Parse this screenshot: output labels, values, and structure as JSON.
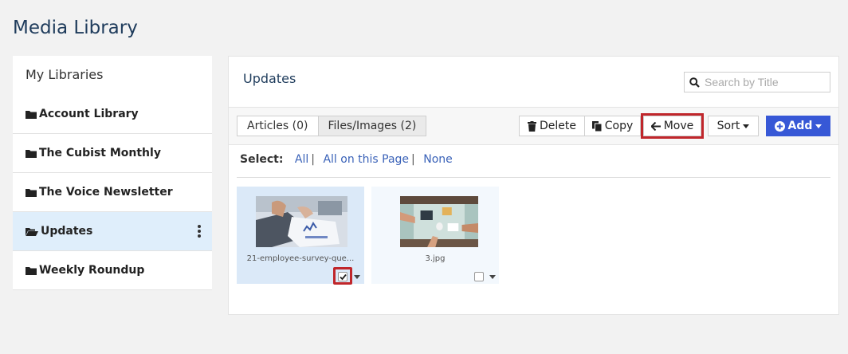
{
  "page": {
    "title": "Media Library"
  },
  "sidebar": {
    "heading": "My Libraries",
    "items": [
      {
        "label": "Account Library",
        "icon": "folder-icon",
        "active": false
      },
      {
        "label": "The Cubist Monthly",
        "icon": "folder-icon",
        "active": false
      },
      {
        "label": "The Voice Newsletter",
        "icon": "folder-icon",
        "active": false
      },
      {
        "label": "Updates",
        "icon": "folder-open-icon",
        "active": true
      },
      {
        "label": "Weekly Roundup",
        "icon": "folder-icon",
        "active": false
      }
    ]
  },
  "main": {
    "folder_title": "Updates",
    "search": {
      "placeholder": "Search by Title",
      "value": ""
    },
    "tabs": [
      {
        "label": "Articles (0)",
        "active": false
      },
      {
        "label": "Files/Images (2)",
        "active": true
      }
    ],
    "toolbar": {
      "delete_label": "Delete",
      "copy_label": "Copy",
      "move_label": "Move",
      "sort_label": "Sort",
      "add_label": "Add"
    },
    "select": {
      "label": "Select:",
      "all": "All",
      "all_on_page": "All on this Page",
      "none": "None"
    },
    "files": [
      {
        "name": "21-employee-survey-que...",
        "checked": true
      },
      {
        "name": "3.jpg",
        "checked": false
      }
    ]
  },
  "colors": {
    "accent": "#3758d6",
    "highlight": "#c0262b",
    "active_item_bg": "#dfeefb",
    "title_color": "#1f3c5c"
  }
}
